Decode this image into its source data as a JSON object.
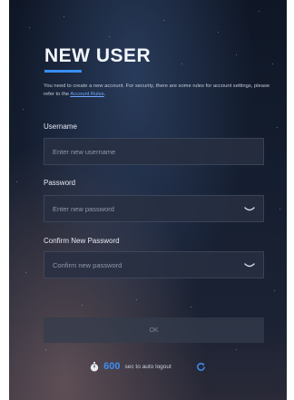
{
  "form": {
    "title": "NEW USER",
    "description_text": "You need to create a new account. For security, there are some rules for account settings, please refer to the ",
    "description_link": "Account Rules",
    "description_end": ".",
    "username": {
      "label": "Username",
      "placeholder": "Enter new username"
    },
    "password": {
      "label": "Password",
      "placeholder": "Enter new password"
    },
    "confirm": {
      "label": "Confirm New Password",
      "placeholder": "Confirm new password"
    },
    "ok_label": "OK"
  },
  "logout": {
    "seconds": "600",
    "suffix": "sec to auto logout"
  },
  "colors": {
    "accent": "#3a8ef0",
    "link": "#6fa8ff"
  }
}
